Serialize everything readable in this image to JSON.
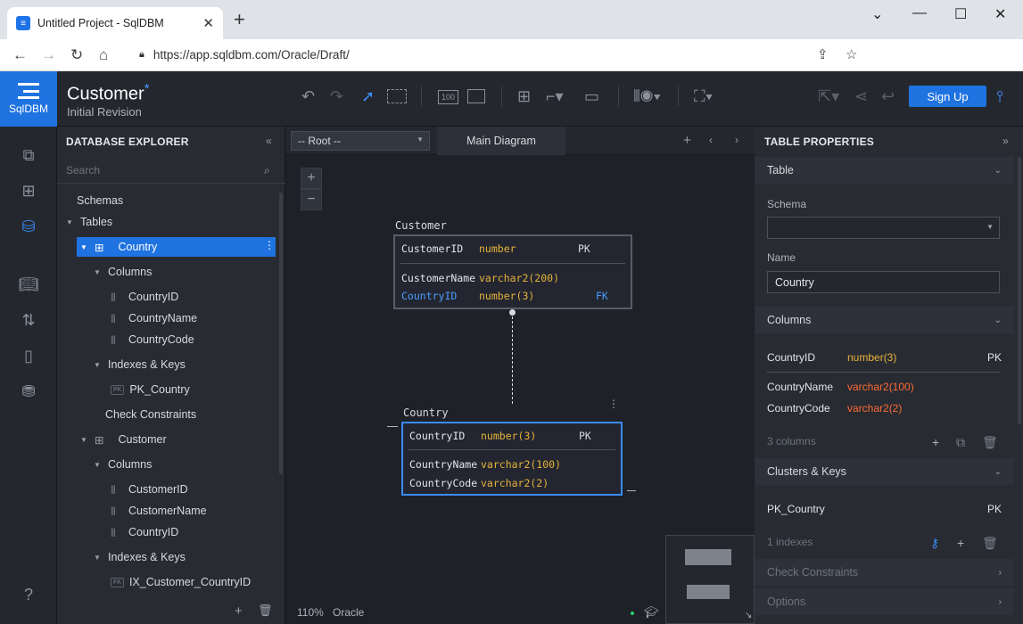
{
  "browser": {
    "tab_title": "Untitled Project - SqlDBM",
    "url": "https://app.sqldbm.com/Oracle/Draft/",
    "new_tab": "+"
  },
  "app": {
    "logo_text": "SqlDBM",
    "project_title": "Customer",
    "unsaved_marker": "*",
    "revision": "Initial Revision",
    "signup_label": "Sign Up",
    "accent_color": "#1f73e0"
  },
  "explorer": {
    "title": "DATABASE EXPLORER",
    "search_placeholder": "Search",
    "schemas": "Schemas",
    "tables": "Tables",
    "country": {
      "name": "Country",
      "columns_label": "Columns",
      "columns": [
        "CountryID",
        "CountryName",
        "CountryCode"
      ],
      "indexes_label": "Indexes & Keys",
      "keys": [
        {
          "badge": "PK",
          "name": "PK_Country"
        }
      ],
      "check_label": "Check Constraints"
    },
    "customer": {
      "name": "Customer",
      "columns_label": "Columns",
      "columns": [
        "CustomerID",
        "CustomerName",
        "CountryID"
      ],
      "indexes_label": "Indexes & Keys",
      "keys": [
        {
          "badge": "FK",
          "name": "IX_Customer_CountryID"
        }
      ]
    }
  },
  "canvas": {
    "root_select": "-- Root --",
    "diagram_tab": "Main Diagram",
    "zoom_in": "+",
    "zoom_out": "−",
    "zoom_level": "110%",
    "db_type": "Oracle",
    "customer_table": {
      "label": "Customer",
      "pk": {
        "name": "CustomerID",
        "type": "number",
        "key": "PK"
      },
      "rows": [
        {
          "name": "CustomerName",
          "type": "varchar2(200)",
          "key": ""
        },
        {
          "name": "CountryID",
          "type": "number(3)",
          "key": "FK"
        }
      ]
    },
    "country_table": {
      "label": "Country",
      "pk": {
        "name": "CountryID",
        "type": "number(3)",
        "key": "PK"
      },
      "rows": [
        {
          "name": "CountryName",
          "type": "varchar2(100)",
          "key": ""
        },
        {
          "name": "CountryCode",
          "type": "varchar2(2)",
          "key": ""
        }
      ]
    }
  },
  "properties": {
    "title": "TABLE PROPERTIES",
    "table_section": "Table",
    "schema_label": "Schema",
    "schema_value": "",
    "name_label": "Name",
    "name_value": "Country",
    "columns_section": "Columns",
    "columns": [
      {
        "name": "CountryID",
        "type": "number(3)",
        "key": "PK"
      },
      {
        "name": "CountryName",
        "type": "varchar2(100)",
        "key": ""
      },
      {
        "name": "CountryCode",
        "type": "varchar2(2)",
        "key": ""
      }
    ],
    "columns_count": "3 columns",
    "clusters_section": "Clusters & Keys",
    "key_name": "PK_Country",
    "key_type": "PK",
    "indexes_count": "1 indexes",
    "check_section": "Check Constraints",
    "options_section": "Options"
  }
}
